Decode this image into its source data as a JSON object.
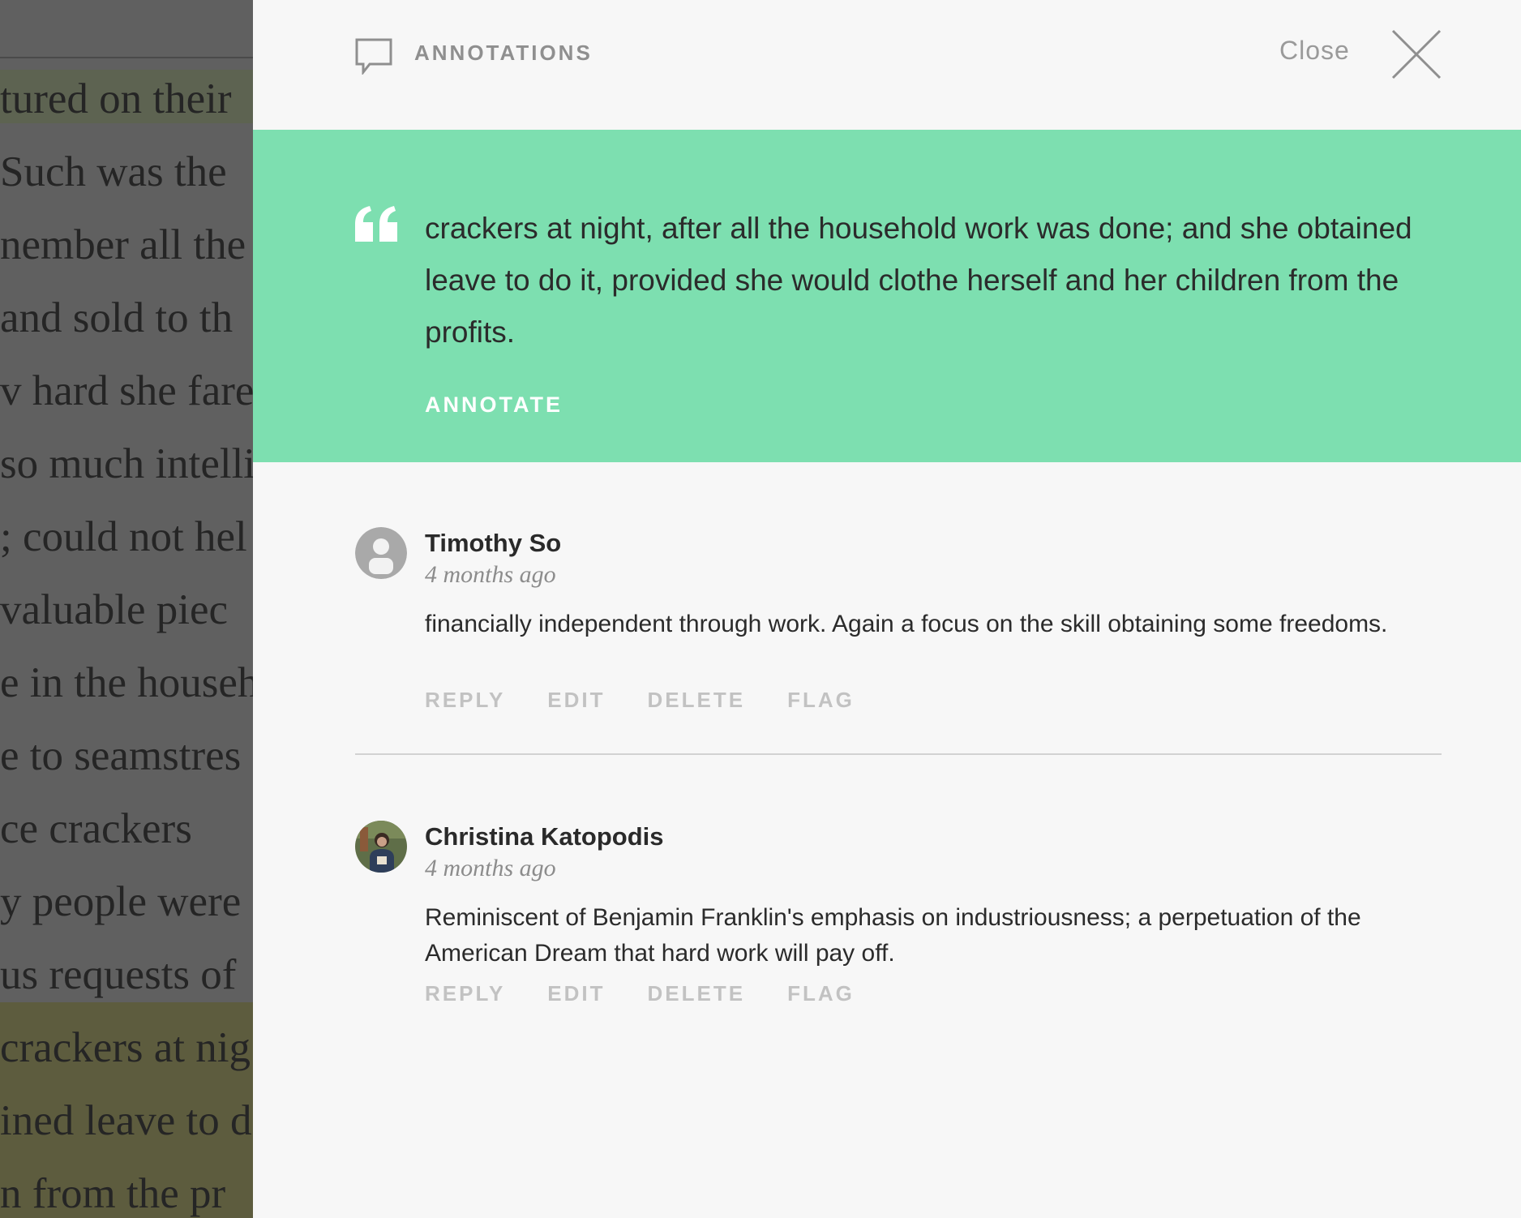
{
  "book": {
    "lines": [
      "tured on their",
      " Such was the",
      "nember all the",
      "and sold to th",
      "v hard she fare",
      "so much intelli",
      "; could not hel",
      " valuable  piec",
      "e in the househ",
      "e to seamstres",
      "ce    crackers",
      "y people were",
      "us requests of",
      "crackers at nig",
      "ined leave to d",
      "n  from  the  pr"
    ]
  },
  "header": {
    "title": "ANNOTATIONS",
    "close_label": "Close"
  },
  "quote": {
    "text": "crackers at night, after all the household work was done; and she obtained leave to do it, provided she would clothe herself and her children from the profits.",
    "annotate_label": "ANNOTATE"
  },
  "comments": [
    {
      "author": "Timothy So",
      "time": "4 months ago",
      "body": "financially independent through work. Again a focus on the skill obtaining some freedoms.",
      "actions": [
        "REPLY",
        "EDIT",
        "DELETE",
        "FLAG"
      ]
    },
    {
      "author": "Christina Katopodis",
      "time": "4 months ago",
      "body": "Reminiscent of Benjamin Franklin's emphasis on industriousness; a perpetuation of the American Dream that hard work will pay off.",
      "actions": [
        "REPLY",
        "EDIT",
        "DELETE",
        "FLAG"
      ]
    }
  ],
  "colors": {
    "accent": "#7ddfb0",
    "panel_bg": "#f7f7f7",
    "muted": "#c2c2c2"
  },
  "icons": [
    "speech-bubble-icon",
    "close-icon",
    "quote-mark-icon",
    "default-avatar-icon"
  ]
}
